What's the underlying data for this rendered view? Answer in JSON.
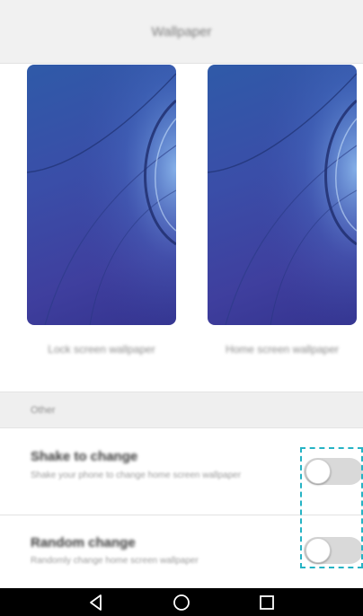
{
  "header": {
    "title": "Wallpaper"
  },
  "wallpapers": {
    "lock_label": "Lock screen wallpaper",
    "home_label": "Home screen wallpaper"
  },
  "section": {
    "title": "Other"
  },
  "settings": [
    {
      "title": "Shake to change",
      "description": "Shake your phone to change home screen wallpaper",
      "enabled": false
    },
    {
      "title": "Random change",
      "description": "Randomly change home screen wallpaper",
      "enabled": false
    }
  ],
  "colors": {
    "accent_highlight": "#26b3c4",
    "toggle_off": "#d9d9d9",
    "wallpaper_blue": "#3a4ea8"
  },
  "navbar": {
    "icons": [
      "back-icon",
      "home-icon",
      "recents-icon"
    ]
  }
}
